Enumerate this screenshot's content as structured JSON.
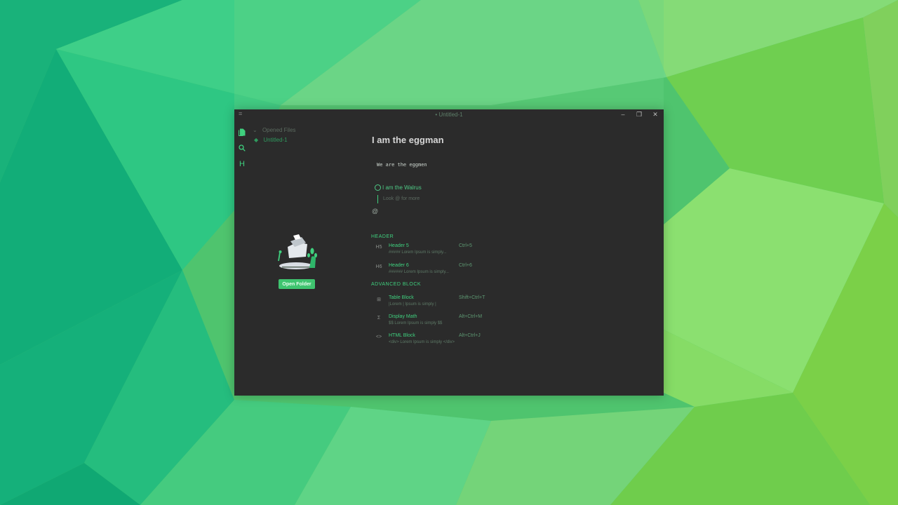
{
  "window": {
    "title": "• Untitled-1",
    "menu_icon": "hamburger-icon",
    "controls": {
      "minimize": "–",
      "maximize": "❐",
      "close": "✕"
    }
  },
  "rail": {
    "icons": [
      "files-icon",
      "search-icon",
      "header-outline-icon"
    ],
    "header_glyph": "H",
    "settings_icon": "gear-icon"
  },
  "sidebar": {
    "opened_files_label": "Opened Files",
    "file_name": "Untitled-1",
    "open_folder_label": "Open Folder"
  },
  "editor": {
    "title": "I am the eggman",
    "code_line": "We are the eggmen",
    "task_text": "I am the Walrus",
    "quote_hint": "Look @ for more",
    "at_trigger": "@"
  },
  "menu": {
    "sections": [
      {
        "label": "HEADER",
        "items": [
          {
            "icon": "H5",
            "name": "Header 5",
            "desc": "##### Lorem Ipsum is simply...",
            "shortcut": "Ctrl+5"
          },
          {
            "icon": "H6",
            "name": "Header 6",
            "desc": "###### Lorem Ipsum is simply...",
            "shortcut": "Ctrl+6"
          }
        ]
      },
      {
        "label": "ADVANCED BLOCK",
        "items": [
          {
            "icon": "⊞",
            "name": "Table Block",
            "desc": "|Lorem | Ipsum is simply |",
            "shortcut": "Shift+Ctrl+T"
          },
          {
            "icon": "Σ",
            "name": "Display Math",
            "desc": "$$ Lorem Ipsum is simply $$",
            "shortcut": "Alt+Ctrl+M"
          },
          {
            "icon": "<>",
            "name": "HTML Block",
            "desc": "<div> Lorem Ipsum is simply </div>",
            "shortcut": "Alt+Ctrl+J"
          }
        ]
      }
    ]
  },
  "colors": {
    "accent": "#3fd07e",
    "window_bg": "#2b2b2b",
    "button": "#3fc46f"
  }
}
